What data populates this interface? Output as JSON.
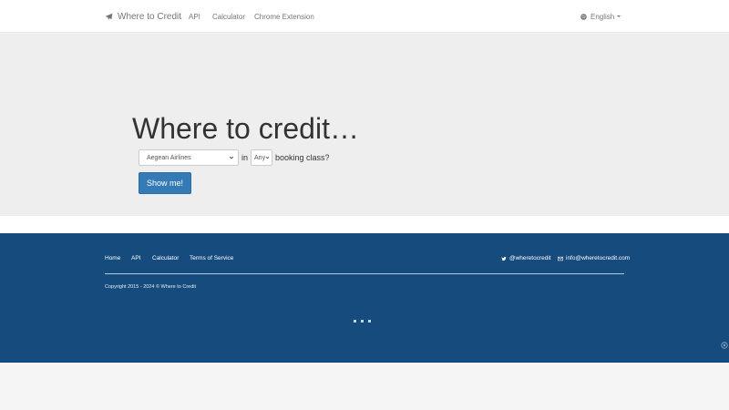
{
  "navbar": {
    "brand": "Where to Credit",
    "links": [
      "API",
      "Calculator",
      "Chrome Extension"
    ],
    "language": "English"
  },
  "hero": {
    "title": "Where to credit…",
    "airline_select": "Aegean Airlines",
    "in_text": "in",
    "class_select": "Any",
    "suffix": "booking class?",
    "button": "Show me!"
  },
  "footer": {
    "links": [
      "Home",
      "API",
      "Calculator",
      "Terms of Service"
    ],
    "twitter": "@wheretocredit",
    "email": "info@wheretocredit.com",
    "copyright": "Copyright 2015 - 2024 © Where to Credit"
  },
  "colors": {
    "primary": "#337ab7",
    "footer_bg": "#154c7d",
    "jumbotron_bg": "#eeeeee"
  },
  "icons": [
    "paper-plane-icon",
    "globe-icon",
    "chevron-down-icon",
    "twitter-icon",
    "envelope-icon",
    "close-circle-icon"
  ]
}
